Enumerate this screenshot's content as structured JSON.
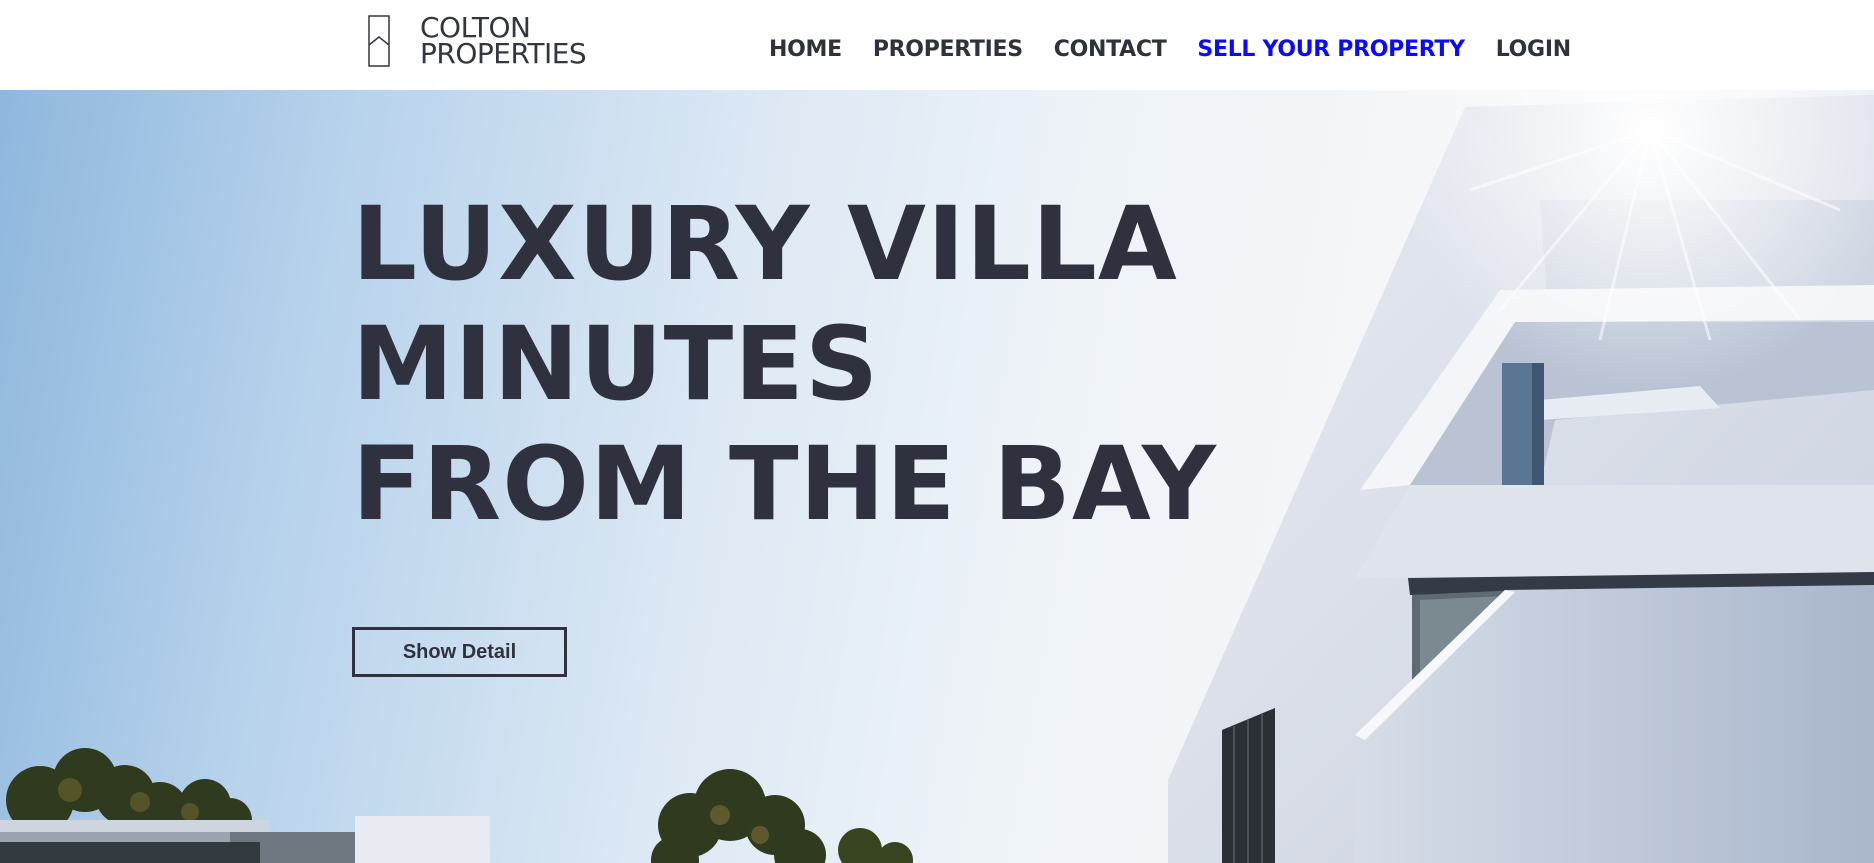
{
  "brand": {
    "line1": "COLTON",
    "line2": "PROPERTIES",
    "icon": "house-outline-icon"
  },
  "nav": {
    "items": [
      {
        "label": "HOME"
      },
      {
        "label": "PROPERTIES"
      },
      {
        "label": "CONTACT"
      },
      {
        "label": "SELL YOUR PROPERTY",
        "active": true
      },
      {
        "label": "LOGIN"
      }
    ]
  },
  "hero": {
    "title_lines": [
      "LUXURY VILLA",
      "MINUTES",
      "FROM THE BAY"
    ],
    "button_label": "Show Detail",
    "image": "modern-white-villa-photo"
  },
  "colors": {
    "text_dark": "#2f323e",
    "nav_active": "#0a0aff",
    "background": "#ffffff"
  }
}
